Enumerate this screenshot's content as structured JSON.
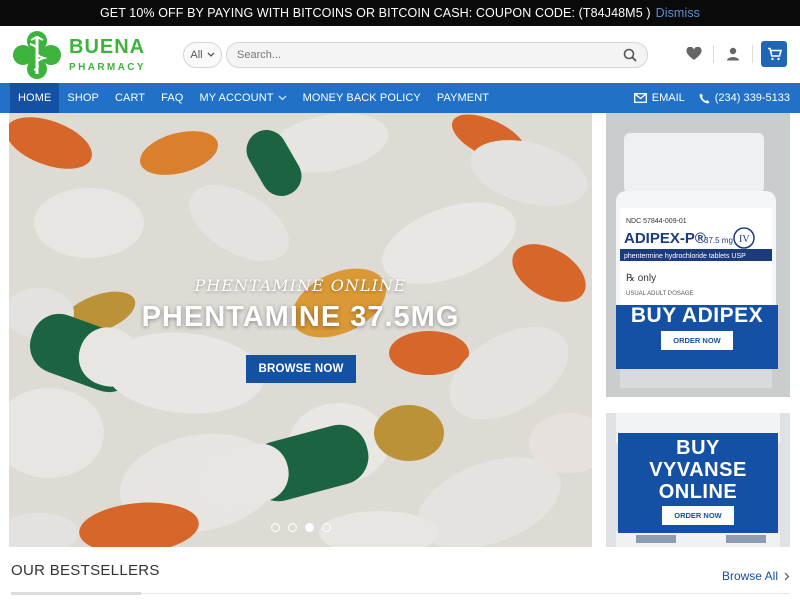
{
  "promo": {
    "text": "GET 10% OFF BY PAYING WITH BITCOINS OR BITCOIN CASH: COUPON CODE: (T84J48M5 )",
    "dismiss": "Dismiss"
  },
  "logo": {
    "line1": "BUENA",
    "line2": "PHARMACY"
  },
  "search": {
    "category": "All",
    "placeholder": "Search..."
  },
  "nav": {
    "items": [
      {
        "label": "HOME"
      },
      {
        "label": "SHOP"
      },
      {
        "label": "CART"
      },
      {
        "label": "FAQ"
      },
      {
        "label": "MY ACCOUNT"
      },
      {
        "label": "MONEY BACK POLICY"
      },
      {
        "label": "PAYMENT"
      }
    ],
    "email": "EMAIL",
    "phone": "(234) 339-5133"
  },
  "hero": {
    "subtitle": "PHENTAMINE ONLINE",
    "title": "PHENTAMINE 37.5MG",
    "button": "BROWSE NOW",
    "active_slide": 3,
    "slide_count": 4
  },
  "side_banner_1": {
    "subtitle": "adipex 37.5mg",
    "title": "BUY ADIPEX",
    "button": "ORDER NOW"
  },
  "side_banner_2": {
    "title_line1": "BUY",
    "title_line2": "VYVANSE",
    "title_line3": "ONLINE",
    "button": "ORDER NOW"
  },
  "bestsellers": {
    "title": "OUR BESTSELLERS",
    "browse_all": "Browse All"
  },
  "colors": {
    "brand_blue": "#2271c8",
    "dark_blue": "#1450a3",
    "logo_green": "#3db33d"
  }
}
